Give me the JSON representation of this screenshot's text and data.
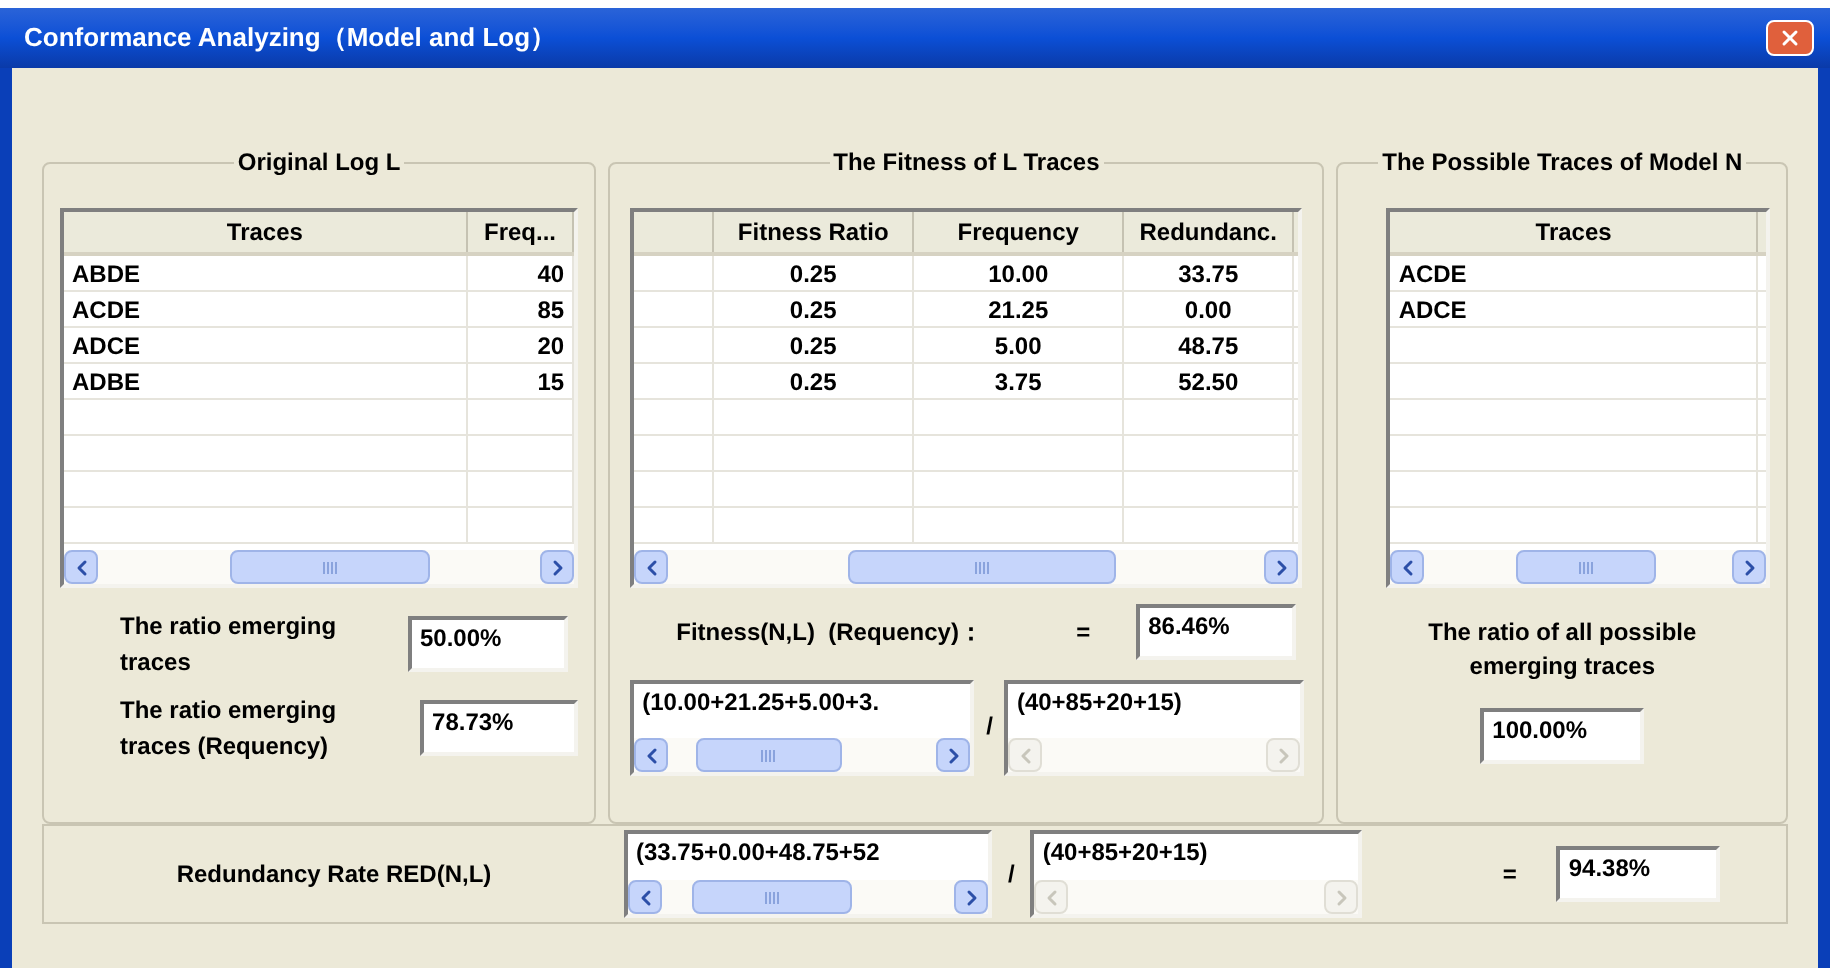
{
  "window": {
    "title": "Conformance Analyzing（Model and Log）"
  },
  "original_log": {
    "title": "Original Log L",
    "columns": [
      "Traces",
      "Freq..."
    ],
    "rows": [
      [
        "ABDE",
        "40"
      ],
      [
        "ACDE",
        "85"
      ],
      [
        "ADCE",
        "20"
      ],
      [
        "ADBE",
        "15"
      ]
    ]
  },
  "ratio_fields": [
    {
      "label": "The ratio emerging traces",
      "value": "50.00%"
    },
    {
      "label": "The ratio emerging traces (Requency)",
      "value": "78.73%"
    }
  ],
  "fitness": {
    "title": "The Fitness of  L Traces",
    "columns": [
      "Fitness Ratio",
      "Frequency",
      "Redundanc."
    ],
    "rows": [
      [
        "0.25",
        "10.00",
        "33.75"
      ],
      [
        "0.25",
        "21.25",
        "0.00"
      ],
      [
        "0.25",
        "5.00",
        "48.75"
      ],
      [
        "0.25",
        "3.75",
        "52.50"
      ]
    ]
  },
  "fitness_result": {
    "label": "Fitness(N,L)  (Requency)：",
    "equals": "=",
    "value": "86.46%"
  },
  "fitness_formula": {
    "numerator": {
      "value": "(10.00+21.25+5.00+3.",
      "scroll_enabled": true
    },
    "divide": "/",
    "denominator": {
      "value": "(40+85+20+15)",
      "scroll_enabled": false
    }
  },
  "model_traces": {
    "title": "The Possible Traces of Model N",
    "columns": [
      "Traces"
    ],
    "rows": [
      [
        "ACDE"
      ],
      [
        "ADCE"
      ]
    ]
  },
  "possible_ratio": {
    "label": "The ratio of all possible emerging traces",
    "value": "100.00%"
  },
  "redundancy": {
    "label": "Redundancy Rate RED(N,L)",
    "numerator": {
      "value": "(33.75+0.00+48.75+52",
      "scroll_enabled": true
    },
    "divide": "/",
    "denominator": {
      "value": "(40+85+20+15)",
      "scroll_enabled": false
    },
    "equals": "=",
    "value": "94.38%"
  }
}
